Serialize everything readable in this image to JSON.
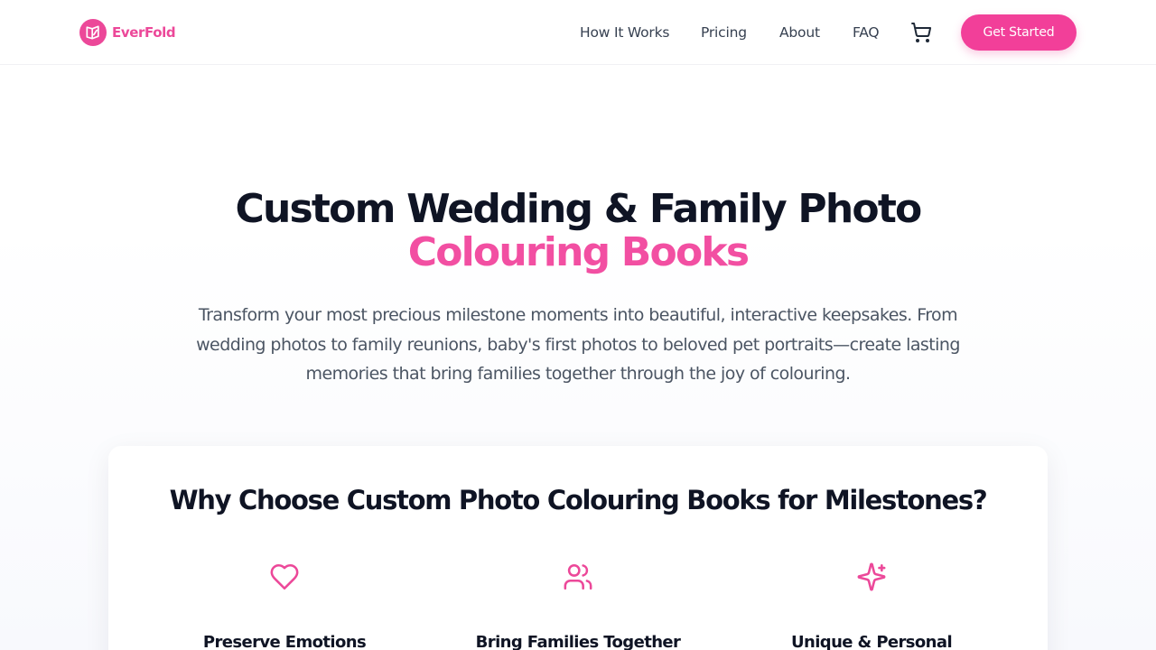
{
  "brand": {
    "name": "EverFold",
    "accent": "#ec4899"
  },
  "nav": {
    "links": [
      "How It Works",
      "Pricing",
      "About",
      "FAQ"
    ],
    "cart_icon": "shopping-cart-icon",
    "cta_label": "Get Started"
  },
  "hero": {
    "title_line1": "Custom Wedding & Family Photo",
    "title_line2": "Colouring Books",
    "subtitle": "Transform your most precious milestone moments into beautiful, interactive keepsakes. From wedding photos to family reunions, baby's first photos to beloved pet portraits—create lasting memories that bring families together through the joy of colouring."
  },
  "why": {
    "title": "Why Choose Custom Photo Colouring Books for Milestones?",
    "features": [
      {
        "icon": "heart-icon",
        "title": "Preserve Emotions"
      },
      {
        "icon": "users-icon",
        "title": "Bring Families Together"
      },
      {
        "icon": "sparkles-icon",
        "title": "Unique & Personal"
      }
    ]
  }
}
